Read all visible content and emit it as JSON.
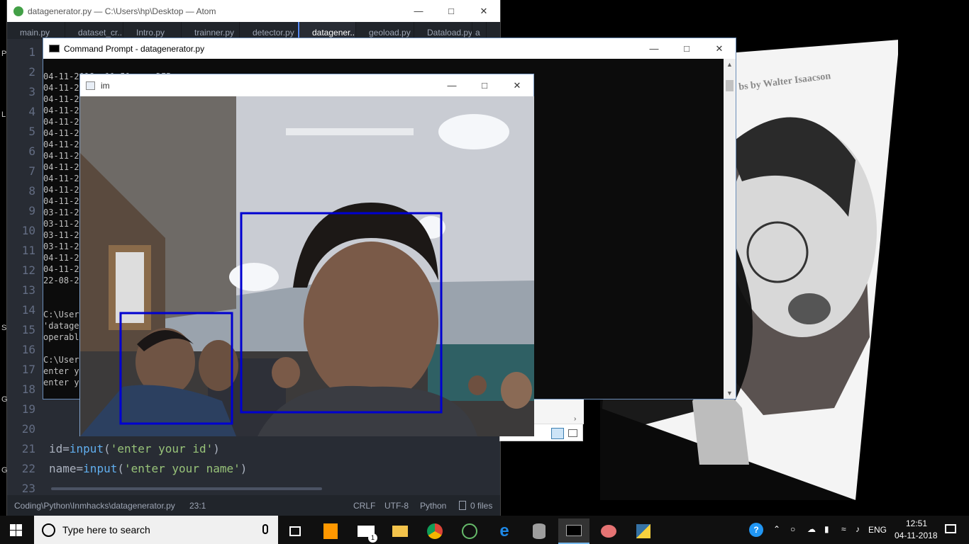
{
  "poster": {
    "caption": "bs by Walter Isaacson"
  },
  "atom": {
    "title": "datagenerator.py — C:\\Users\\hp\\Desktop — Atom",
    "tabs": [
      "main.py",
      "dataset_cr...",
      "Intro.py",
      "trainner.py",
      "detector.py",
      "datagener...",
      "geoload.py",
      "Dataload.py",
      "a"
    ],
    "active_tab": 5,
    "left_letters": [
      "P",
      "L",
      "S",
      "G",
      "G"
    ],
    "line_numbers": [
      "1",
      "2",
      "3",
      "4",
      "5",
      "6",
      "7",
      "8",
      "9",
      "10",
      "11",
      "12",
      "13",
      "14",
      "15",
      "16",
      "17",
      "18",
      "19",
      "20",
      "21",
      "22",
      "23"
    ],
    "code": {
      "line21": {
        "var": "id=",
        "fn": "input",
        "open": "(",
        "str": "'enter your id'",
        "close": ")"
      },
      "line22": {
        "var": "name=",
        "fn": "input",
        "open": "(",
        "str": "'enter your name'",
        "close": ")"
      }
    },
    "status": {
      "path": "Coding\\Python\\Inmhacks\\datagenerator.py",
      "cursor": "23:1",
      "eol": "CRLF",
      "encoding": "UTF-8",
      "grammar": "Python",
      "files": "0 files"
    }
  },
  "cmd": {
    "title": "Command Prompt - datagenerator.py",
    "lines": [
      "04-11-2018  11:51    <DIR>",
      "04-11-2",
      "04-11-2",
      "04-11-2",
      "04-11-2",
      "04-11-2",
      "04-11-2",
      "04-11-2",
      "04-11-2",
      "04-11-2",
      "04-11-2",
      "04-11-2",
      "03-11-2",
      "03-11-2",
      "03-11-2",
      "03-11-2",
      "04-11-2",
      "04-11-2",
      "22-08-2",
      "",
      "",
      "C:\\User",
      "'datage",
      "operabl",
      "",
      "C:\\User",
      "enter y",
      "enter y"
    ]
  },
  "im": {
    "title": "im"
  },
  "taskbar": {
    "search_placeholder": "Type here to search",
    "language": "ENG",
    "time": "12:51",
    "date": "04-11-2018",
    "mail_badge": "1"
  },
  "colors": {
    "atom_bg": "#282c34",
    "face_box": "#0000d0",
    "accent": "#568af2"
  }
}
